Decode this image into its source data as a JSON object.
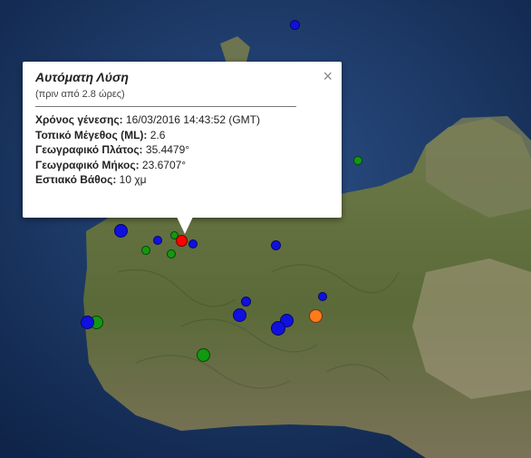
{
  "popup": {
    "title": "Αυτόματη Λύση",
    "subtitle": "(πριν από 2.8 ώρες)",
    "close_label": "×",
    "rows": [
      {
        "label": "Χρόνος γένεσης:",
        "value": " 16/03/2016  14:43:52 (GMT)"
      },
      {
        "label": "Τοπικό Μέγεθος (ML):",
        "value": " 2.6"
      },
      {
        "label": "Γεωγραφικό Πλάτος:",
        "value": " 35.4479°"
      },
      {
        "label": "Γεωγραφικό Μήκος:",
        "value": " 23.6707°"
      },
      {
        "label": "Εστιακό Βάθος:",
        "value": " 10 χμ"
      }
    ]
  },
  "colors": {
    "sea": "#1c3a66",
    "land": "#5c6a3a",
    "marker_red": "#ff0000",
    "marker_blue": "#1010e0",
    "marker_green": "#119911",
    "marker_orange": "#ff7b1a"
  }
}
